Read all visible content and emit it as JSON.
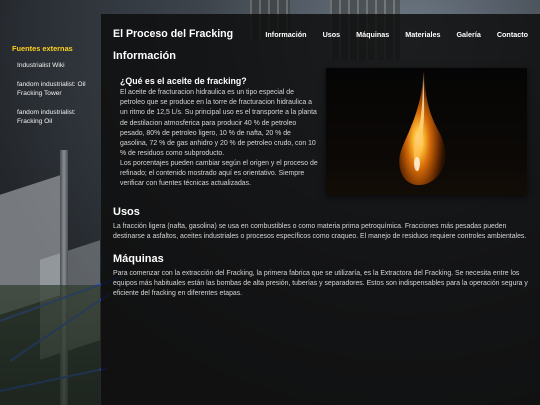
{
  "page": {
    "title": "El Proceso del Fracking"
  },
  "nav": {
    "items": [
      "Información",
      "Usos",
      "Máquinas",
      "Materiales",
      "Galería",
      "Contacto"
    ]
  },
  "sidebar": {
    "heading": "Fuentes externas",
    "links": [
      "Industrialist Wiki",
      "fandom industrialist: Oil Fracking Tower",
      "fandom industrialist: Fracking Oil"
    ]
  },
  "informacion": {
    "heading": "Información",
    "question": "¿Qué es el aceite de fracking?",
    "body": "El aceite de fracturacion hidraulica es un tipo especial de petroleo que se produce en la torre de fracturacion hidraulica a un ritmo de 12,5 L/s. Su principal uso es el transporte a la planta de destilacion atmosferica para producir 40 % de petroleo pesado, 80% de petroleo ligero, 10 % de nafta, 20 % de gasolina, 72 % de gas anhidro y 20 % de petroleo crudo, con 10 % de residuos como subproducto.",
    "note": "Los porcentajes pueden cambiar según el origen y el proceso de refinado; el contenido mostrado aquí es orientativo. Siempre verificar con fuentes técnicas actualizadas.",
    "image": "oil-drop-image"
  },
  "usos": {
    "heading": "Usos",
    "body": "La fracción ligera (nafta, gasolina) se usa en combustibles o como materia prima petroquímica. Fracciones más pesadas pueden destinarse a asfaltos, aceites industriales o procesos específicos como craqueo. El manejo de residuos requiere controles ambientales."
  },
  "maquinas": {
    "heading": "Máquinas",
    "body": "Para comenzar con la extracción del Fracking, la primera fabrica que se utilizaría, es la Extractora del Fracking. Se necesita entre los equipos más habituales están las bombas de alta presión, tuberías y separadores. Estos son indispensables para la operación segura y eficiente del fracking en diferentes etapas."
  },
  "colors": {
    "accent": "#ffd11a",
    "panel": "#0e0e0e",
    "oil": "#e07a10"
  }
}
